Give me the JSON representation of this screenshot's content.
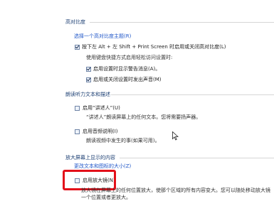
{
  "high_contrast": {
    "header": "高对比度",
    "select_theme_link": "选择一个高对比度主题(R)",
    "toggle_shortcut": {
      "label": "按下左 Alt + 左 Shift + Print Screen 时启用或关闭高对比度(L)",
      "checked": true
    },
    "sub_header": "使用键盘快捷方式启用轻松访问设置时:",
    "warning_message": {
      "label": "启用设置时显示警告消息(A)。",
      "checked": true
    },
    "sound": {
      "label": "启用或关闭设置时发出声音(M)",
      "checked": true
    }
  },
  "narration": {
    "header": "朗读听力文本和描述",
    "narrator": {
      "label": "启用“讲述人”(U)",
      "checked": false
    },
    "narrator_desc": "“讲述人”朗读屏幕上的任何文本。您将需要扬声器。",
    "audio_desc": {
      "label": "启用音频说明(I)",
      "checked": false
    },
    "audio_desc_desc": "朗读视频中发生的事(如果可用)。"
  },
  "magnify": {
    "header": "放大屏幕上显示的内容",
    "text_size_link": "更改文本和图标的大小(Z)",
    "magnifier": {
      "label": "启用放大镜(N)",
      "checked": false
    },
    "magnifier_desc_1": "放大镜在屏幕上的任何位置放大，使那个区域的所有内容变大。您可以随处移动放大镜",
    "magnifier_desc_2": "一个位置或者更放大。"
  }
}
